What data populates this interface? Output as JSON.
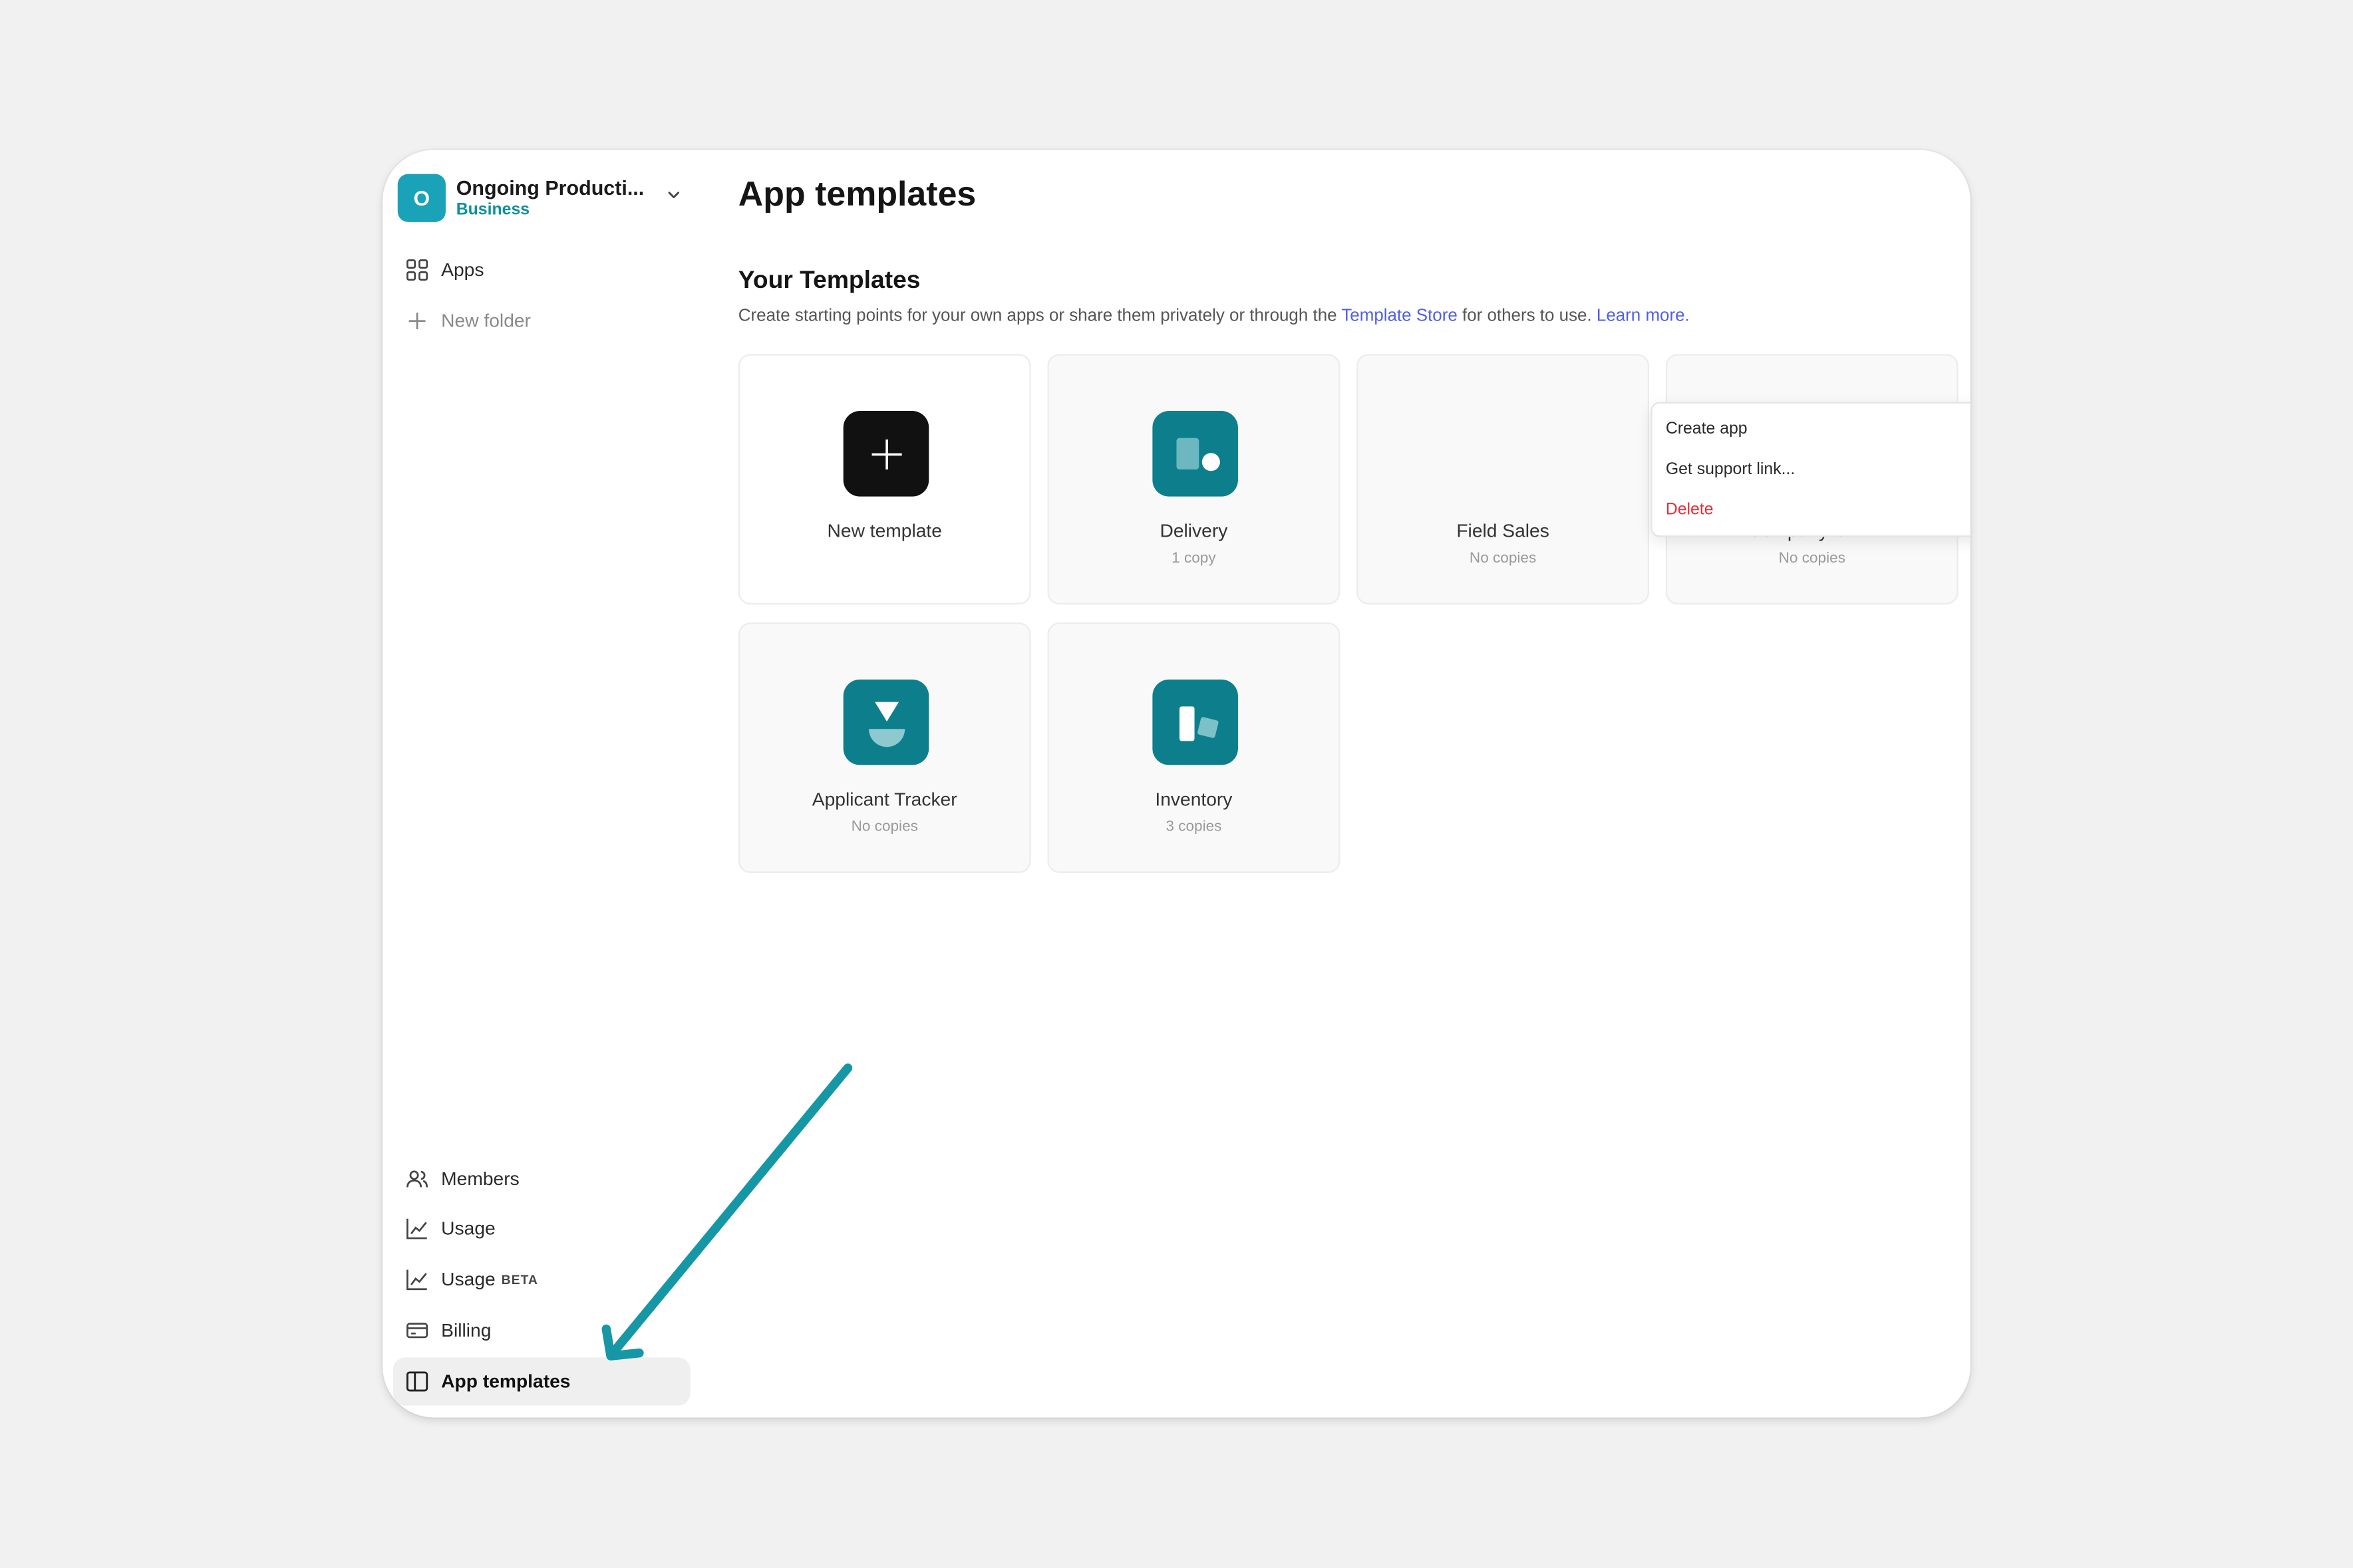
{
  "sidebar": {
    "org_initial": "O",
    "org_name": "Ongoing Producti...",
    "org_plan": "Business",
    "items_top": [
      {
        "label": "Apps",
        "icon": "grid-icon"
      },
      {
        "label": "New folder",
        "icon": "plus-icon"
      }
    ],
    "items_bottom": [
      {
        "label": "Members",
        "icon": "users-icon"
      },
      {
        "label": "Usage",
        "icon": "chart-icon"
      },
      {
        "label": "Usage",
        "badge": "BETA",
        "icon": "chart-icon"
      },
      {
        "label": "Billing",
        "icon": "credit-card-icon"
      },
      {
        "label": "App templates",
        "icon": "book-icon"
      }
    ]
  },
  "main": {
    "title": "App templates",
    "section_title": "Your Templates",
    "desc_before": "Create starting points for your own apps or share them privately or through the ",
    "desc_link": "Template Store",
    "desc_middle": " for others to use. ",
    "desc_learn": "Learn more.",
    "templates": [
      {
        "name": "New template",
        "copies": ""
      },
      {
        "name": "Delivery",
        "copies": "1 copy"
      },
      {
        "name": "Field Sales",
        "copies": "No copies"
      },
      {
        "name": "Company CRM",
        "copies": "No copies"
      },
      {
        "name": "Applicant Tracker",
        "copies": "No copies"
      },
      {
        "name": "Inventory",
        "copies": "3 copies"
      }
    ],
    "context_menu": {
      "create": "Create app",
      "support": "Get support link...",
      "delete": "Delete"
    }
  },
  "colors": {
    "accent": "#1aa3b8",
    "teal_tile": "#0d7f8c",
    "orange_tile": "#f04a0c",
    "link": "#4f5ee8",
    "danger": "#e0303a",
    "arrow": "#1697a6"
  }
}
